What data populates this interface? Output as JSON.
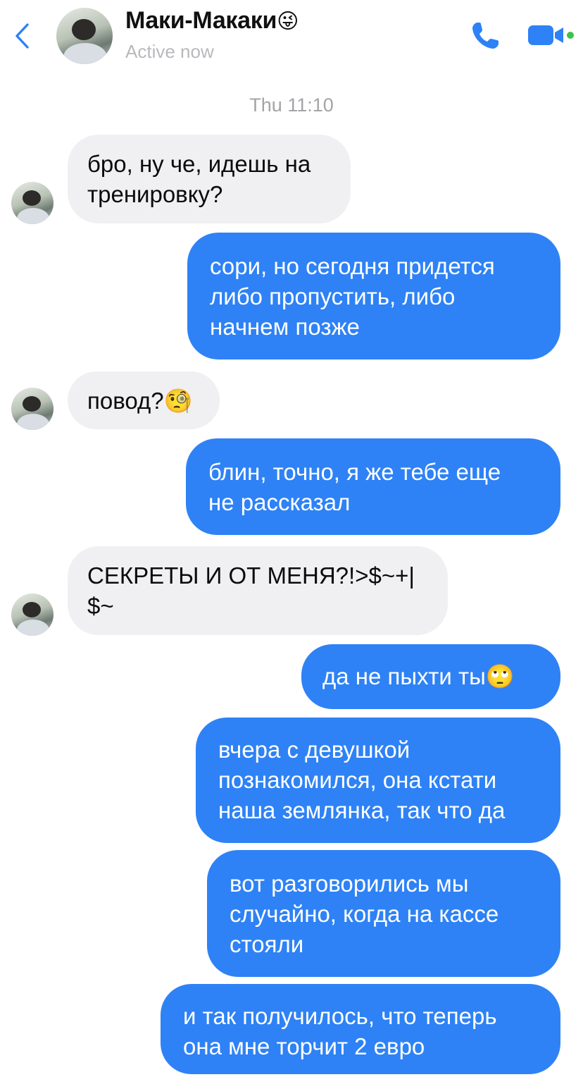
{
  "header": {
    "contact_name": "Маки-Макаки",
    "name_emoji": "😜",
    "status": "Active now",
    "icons": {
      "back": "chevron-left-icon",
      "call": "phone-icon",
      "video": "video-camera-icon"
    },
    "active_dot_color": "#3ec24a",
    "accent_color": "#2e82f5"
  },
  "timestamp": "Thu 11:10",
  "messages": [
    {
      "direction": "incoming",
      "text": "бро, ну че, идешь на\nтренировку?"
    },
    {
      "direction": "outgoing",
      "text": "сори, но сегодня придется\nлибо пропустить, либо\nначнем позже"
    },
    {
      "direction": "incoming",
      "text": "повод?🧐"
    },
    {
      "direction": "outgoing",
      "text": "блин, точно, я же тебе еще\nне рассказал"
    },
    {
      "direction": "incoming",
      "text": "СЕКРЕТЫ И ОТ МЕНЯ?!>$~+|\n$~"
    },
    {
      "direction": "outgoing",
      "text": "да не пыхти ты🙄"
    },
    {
      "direction": "outgoing",
      "text": "вчера с девушкой\nпознакомился, она кстати\nнаша землянка, так что да"
    },
    {
      "direction": "outgoing",
      "text": "вот разговорились мы\nслучайно, когда на кассе\nстояли"
    },
    {
      "direction": "outgoing",
      "text": "и так получилось, что теперь\nона мне торчит 2 евро"
    }
  ]
}
